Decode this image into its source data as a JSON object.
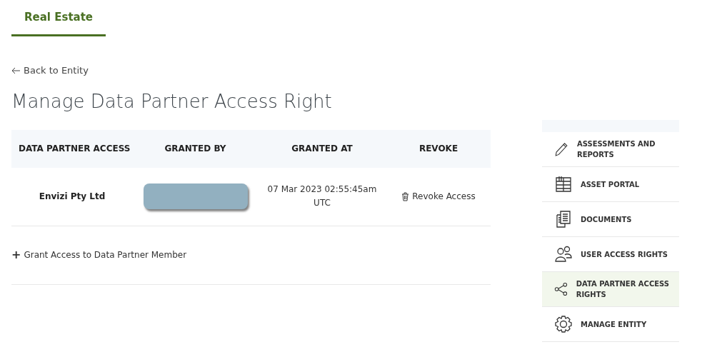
{
  "tabs": [
    {
      "label": "Real Estate",
      "selected": true
    }
  ],
  "back_link": "Back to Entity",
  "title": "Manage Data Partner Access Right",
  "table": {
    "columns": [
      "DATA PARTNER ACCESS",
      "GRANTED BY",
      "GRANTED AT",
      "REVOKE"
    ],
    "rows": [
      {
        "partner": "Envizi Pty Ltd",
        "granted_at": [
          "07 Mar 2023 02:55:45am",
          "UTC"
        ],
        "revoke": "Revoke Access"
      }
    ]
  },
  "grant_link": {
    "icon": "+",
    "label": "Grant Access to Data Partner Member"
  },
  "sidebar": {
    "items": [
      {
        "kind": "pencil",
        "label": "ASSESSMENTS AND REPORTS",
        "selected": false
      },
      {
        "kind": "grid",
        "label": "ASSET PORTAL",
        "selected": false
      },
      {
        "kind": "documents",
        "label": "DOCUMENTS",
        "selected": false
      },
      {
        "kind": "users",
        "label": "USER ACCESS RIGHTS",
        "selected": false
      },
      {
        "kind": "share",
        "label": "DATA PARTNER ACCESS RIGHTS",
        "selected": true
      },
      {
        "kind": "gear",
        "label": "MANAGE ENTITY",
        "selected": false
      }
    ]
  }
}
